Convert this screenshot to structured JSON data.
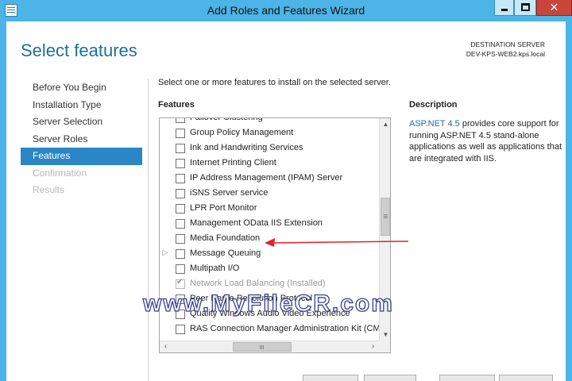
{
  "window": {
    "title": "Add Roles and Features Wizard",
    "minimize_glyph": "",
    "maximize_glyph": "",
    "close_glyph": "✕"
  },
  "colors": {
    "titlebar": "#4cb4e6",
    "accent": "#2a86c5",
    "title_text": "#1e6f99",
    "close_button": "#c9453a"
  },
  "page": {
    "title": "Select features",
    "destination_label": "DESTINATION SERVER",
    "destination_server": "DEV-KPS-WEB2.kps.local"
  },
  "nav": {
    "items": [
      {
        "label": "Before You Begin",
        "state": "normal"
      },
      {
        "label": "Installation Type",
        "state": "normal"
      },
      {
        "label": "Server Selection",
        "state": "normal"
      },
      {
        "label": "Server Roles",
        "state": "normal"
      },
      {
        "label": "Features",
        "state": "active"
      },
      {
        "label": "Confirmation",
        "state": "disabled"
      },
      {
        "label": "Results",
        "state": "disabled"
      }
    ]
  },
  "main": {
    "instruction": "Select one or more features to install on the selected server.",
    "features_heading": "Features",
    "features": [
      {
        "label": "Failover Clustering",
        "checked": false,
        "expandable": false,
        "dim": false
      },
      {
        "label": "Group Policy Management",
        "checked": false,
        "expandable": false,
        "dim": false
      },
      {
        "label": "Ink and Handwriting Services",
        "checked": false,
        "expandable": false,
        "dim": false
      },
      {
        "label": "Internet Printing Client",
        "checked": false,
        "expandable": false,
        "dim": false
      },
      {
        "label": "IP Address Management (IPAM) Server",
        "checked": false,
        "expandable": false,
        "dim": false
      },
      {
        "label": "iSNS Server service",
        "checked": false,
        "expandable": false,
        "dim": false
      },
      {
        "label": "LPR Port Monitor",
        "checked": false,
        "expandable": false,
        "dim": false
      },
      {
        "label": "Management OData IIS Extension",
        "checked": false,
        "expandable": false,
        "dim": false
      },
      {
        "label": "Media Foundation",
        "checked": false,
        "expandable": false,
        "dim": false
      },
      {
        "label": "Message Queuing",
        "checked": false,
        "expandable": true,
        "dim": false
      },
      {
        "label": "Multipath I/O",
        "checked": false,
        "expandable": false,
        "dim": false
      },
      {
        "label": "Network Load Balancing (Installed)",
        "checked": true,
        "expandable": false,
        "dim": true
      },
      {
        "label": "Peer Name Resolution Protocol",
        "checked": false,
        "expandable": false,
        "dim": false
      },
      {
        "label": "Quality Windows Audio Video Experience",
        "checked": false,
        "expandable": false,
        "dim": false
      },
      {
        "label": "RAS Connection Manager Administration Kit (CMA",
        "checked": false,
        "expandable": false,
        "dim": false
      }
    ],
    "scroll": {
      "vertical_position": 0.42,
      "horizontal_position": 0.45,
      "horizontal_thumb_fraction": 0.3
    }
  },
  "description": {
    "heading": "Description",
    "highlight": "ASP.NET 4.5",
    "text": " provides core support for running ASP.NET 4.5 stand-alone applications as well as applications that are integrated with IIS."
  },
  "annotation": {
    "points_to": "Media Foundation",
    "color": "#e8202a"
  },
  "watermark": {
    "text": "www.MyFileCR.com"
  },
  "icons": [
    "window-icon",
    "minimize-icon",
    "maximize-icon",
    "close-icon",
    "expand-arrow-icon",
    "checkbox-icon",
    "scroll-up-icon",
    "scroll-down-icon",
    "scroll-left-icon",
    "scroll-right-icon",
    "annotation-arrow-icon"
  ]
}
